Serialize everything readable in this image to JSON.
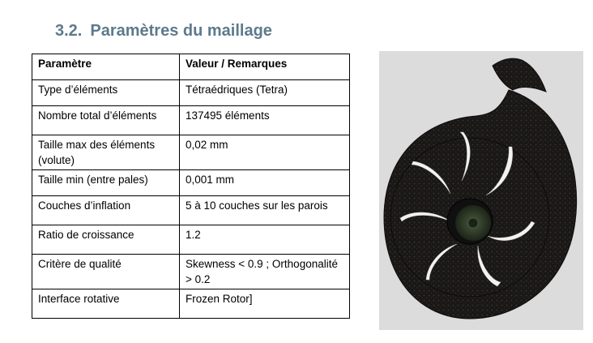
{
  "section": {
    "number": "3.2.",
    "title": "Paramètres du maillage"
  },
  "table": {
    "headers": [
      "Paramètre",
      "Valeur / Remarques"
    ],
    "rows": [
      {
        "param": "Type d’éléments",
        "value": "Tétraédriques (Tetra)"
      },
      {
        "param": "Nombre total d’éléments",
        "value": "137495 éléments"
      },
      {
        "param": "Taille max des éléments (volute)",
        "value": "0,02 mm"
      },
      {
        "param": "Taille min (entre pales)",
        "value": "0,001 mm"
      },
      {
        "param": "Couches d’inflation",
        "value": "5 à 10 couches sur les parois"
      },
      {
        "param": "Ratio de croissance",
        "value": "1.2"
      },
      {
        "param": "Critère de qualité",
        "value": "Skewness < 0.9 ; Orthogonalité > 0.2"
      },
      {
        "param": "Interface rotative",
        "value": "Frozen Rotor]"
      }
    ]
  },
  "figure": {
    "background": "#dcdcdc",
    "mesh_color": "#1a1816",
    "blade_color": "#f2f2f2",
    "hub_color": "#2e3a2a"
  }
}
